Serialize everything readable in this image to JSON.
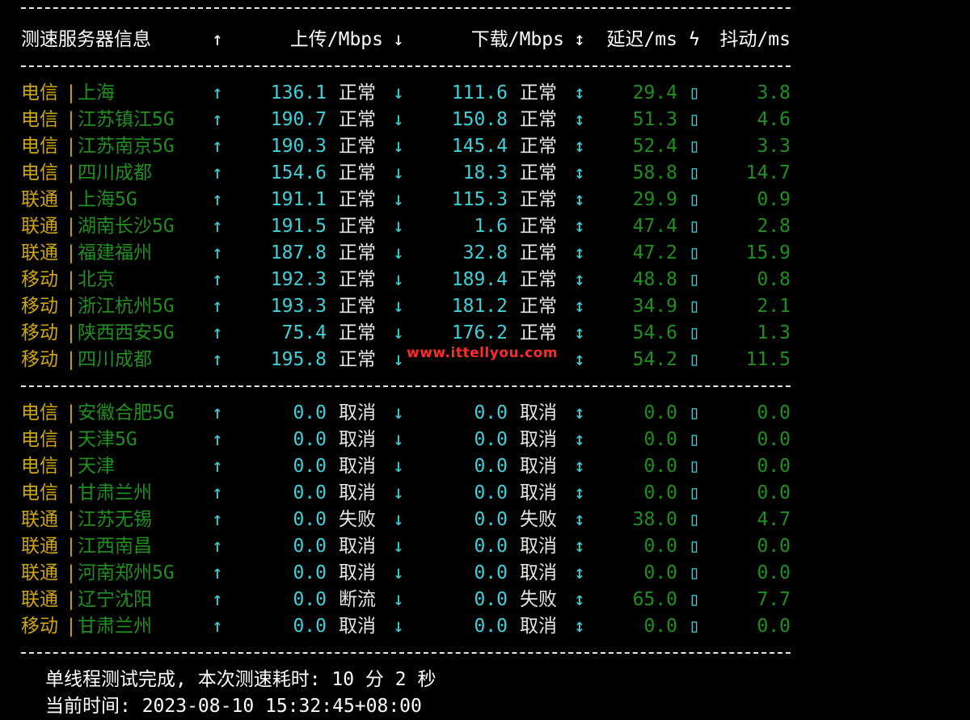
{
  "colors": {
    "background": "#000000",
    "isp": "#cfa70a",
    "city": "#1f8f1f",
    "speed": "#3fd0d8",
    "latency": "#1f8f1f",
    "watermark": "#ff2a2a"
  },
  "icons": {
    "up": "↑",
    "down": "↓",
    "updown": "↕",
    "bolt": "ϟ",
    "separator": "|",
    "missing_glyph": "▯"
  },
  "header": {
    "server": "测速服务器信息",
    "upload": "上传/Mbps",
    "download": "下载/Mbps",
    "latency": "延迟/ms",
    "jitter": "抖动/ms"
  },
  "group1": [
    {
      "isp": "电信",
      "city": "上海",
      "up": "136.1",
      "up_status": "正常",
      "down": "111.6",
      "down_status": "正常",
      "latency": "29.4",
      "jitter": "3.8"
    },
    {
      "isp": "电信",
      "city": "江苏镇江5G",
      "up": "190.7",
      "up_status": "正常",
      "down": "150.8",
      "down_status": "正常",
      "latency": "51.3",
      "jitter": "4.6"
    },
    {
      "isp": "电信",
      "city": "江苏南京5G",
      "up": "190.3",
      "up_status": "正常",
      "down": "145.4",
      "down_status": "正常",
      "latency": "52.4",
      "jitter": "3.3"
    },
    {
      "isp": "电信",
      "city": "四川成都",
      "up": "154.6",
      "up_status": "正常",
      "down": "18.3",
      "down_status": "正常",
      "latency": "58.8",
      "jitter": "14.7"
    },
    {
      "isp": "联通",
      "city": "上海5G",
      "up": "191.1",
      "up_status": "正常",
      "down": "115.3",
      "down_status": "正常",
      "latency": "29.9",
      "jitter": "0.9"
    },
    {
      "isp": "联通",
      "city": "湖南长沙5G",
      "up": "191.5",
      "up_status": "正常",
      "down": "1.6",
      "down_status": "正常",
      "latency": "47.4",
      "jitter": "2.8"
    },
    {
      "isp": "联通",
      "city": "福建福州",
      "up": "187.8",
      "up_status": "正常",
      "down": "32.8",
      "down_status": "正常",
      "latency": "47.2",
      "jitter": "15.9"
    },
    {
      "isp": "移动",
      "city": "北京",
      "up": "192.3",
      "up_status": "正常",
      "down": "189.4",
      "down_status": "正常",
      "latency": "48.8",
      "jitter": "0.8"
    },
    {
      "isp": "移动",
      "city": "浙江杭州5G",
      "up": "193.3",
      "up_status": "正常",
      "down": "181.2",
      "down_status": "正常",
      "latency": "34.9",
      "jitter": "2.1"
    },
    {
      "isp": "移动",
      "city": "陕西西安5G",
      "up": "75.4",
      "up_status": "正常",
      "down": "176.2",
      "down_status": "正常",
      "latency": "54.6",
      "jitter": "1.3"
    },
    {
      "isp": "移动",
      "city": "四川成都",
      "up": "195.8",
      "up_status": "正常",
      "down": "",
      "down_status": "",
      "latency": "54.2",
      "jitter": "11.5"
    }
  ],
  "group2": [
    {
      "isp": "电信",
      "city": "安徽合肥5G",
      "up": "0.0",
      "up_status": "取消",
      "down": "0.0",
      "down_status": "取消",
      "latency": "0.0",
      "jitter": "0.0"
    },
    {
      "isp": "电信",
      "city": "天津5G",
      "up": "0.0",
      "up_status": "取消",
      "down": "0.0",
      "down_status": "取消",
      "latency": "0.0",
      "jitter": "0.0"
    },
    {
      "isp": "电信",
      "city": "天津",
      "up": "0.0",
      "up_status": "取消",
      "down": "0.0",
      "down_status": "取消",
      "latency": "0.0",
      "jitter": "0.0"
    },
    {
      "isp": "电信",
      "city": "甘肃兰州",
      "up": "0.0",
      "up_status": "取消",
      "down": "0.0",
      "down_status": "取消",
      "latency": "0.0",
      "jitter": "0.0"
    },
    {
      "isp": "联通",
      "city": "江苏无锡",
      "up": "0.0",
      "up_status": "失败",
      "down": "0.0",
      "down_status": "失败",
      "latency": "38.0",
      "jitter": "4.7"
    },
    {
      "isp": "联通",
      "city": "江西南昌",
      "up": "0.0",
      "up_status": "取消",
      "down": "0.0",
      "down_status": "取消",
      "latency": "0.0",
      "jitter": "0.0"
    },
    {
      "isp": "联通",
      "city": "河南郑州5G",
      "up": "0.0",
      "up_status": "取消",
      "down": "0.0",
      "down_status": "取消",
      "latency": "0.0",
      "jitter": "0.0"
    },
    {
      "isp": "联通",
      "city": "辽宁沈阳",
      "up": "0.0",
      "up_status": "断流",
      "down": "0.0",
      "down_status": "失败",
      "latency": "65.0",
      "jitter": "7.7"
    },
    {
      "isp": "移动",
      "city": "甘肃兰州",
      "up": "0.0",
      "up_status": "取消",
      "down": "0.0",
      "down_status": "取消",
      "latency": "0.0",
      "jitter": "0.0"
    }
  ],
  "watermark": "www.ittellyou.com",
  "footer": {
    "complete": "单线程测试完成, 本次测速耗时: 10 分 2 秒",
    "current_time": "当前时间: 2023-08-10 15:32:45+08:00"
  }
}
